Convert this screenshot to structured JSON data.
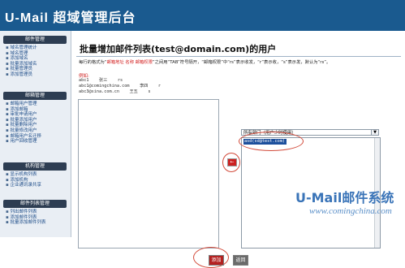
{
  "header": {
    "title": "U-Mail 超域管理后台"
  },
  "sidebar": {
    "sections": [
      {
        "title": "邮件管理",
        "items": [
          "域名管理统计",
          "域名管理",
          "添加域名",
          "批量添加域名",
          "批量管理员",
          "添加管理员"
        ]
      },
      {
        "title": "邮箱管理",
        "items": [
          "邮箱用户管理",
          "添加邮箱",
          "审批申请用户",
          "批量添加用户",
          "批量删除用户",
          "批量修改用户",
          "邮箱用户名迁移",
          "用户回收管理"
        ]
      },
      {
        "title": "机构管理",
        "items": [
          "显示机构列表",
          "添加机构",
          "企业通讯录共享"
        ]
      },
      {
        "title": "邮件列表管理",
        "items": [
          "列出邮件列表",
          "添加邮件列表",
          "批量添加邮件列表"
        ]
      }
    ]
  },
  "main": {
    "title": "批量增加邮件列表(test@domain.com)的用户",
    "description_prefix": "每行的格式为“",
    "description_fields": "邮箱地址 名称 邮箱权限",
    "description_suffix": "”之间用“TAB”符号隔开，“邮箱权限”中“rs”表示收发，“r”表示收，“s”表示发，默认为“rs”。",
    "example_label": "例如:",
    "example_lines": [
      "abc1    张三    rs",
      "abc1@comingchina.com    李四    r",
      "abc3@sina.com.cn    王五    s"
    ],
    "move_button_label": "←",
    "select": {
      "value": "所有部门（用户少时使用）"
    },
    "list_options": [
      "asd(sd@test.com)"
    ],
    "add_button_label": "添加",
    "back_button_label": "返回"
  },
  "watermark": {
    "brand": "U-Mail邮件系统",
    "url": "www.comingchina.com"
  }
}
